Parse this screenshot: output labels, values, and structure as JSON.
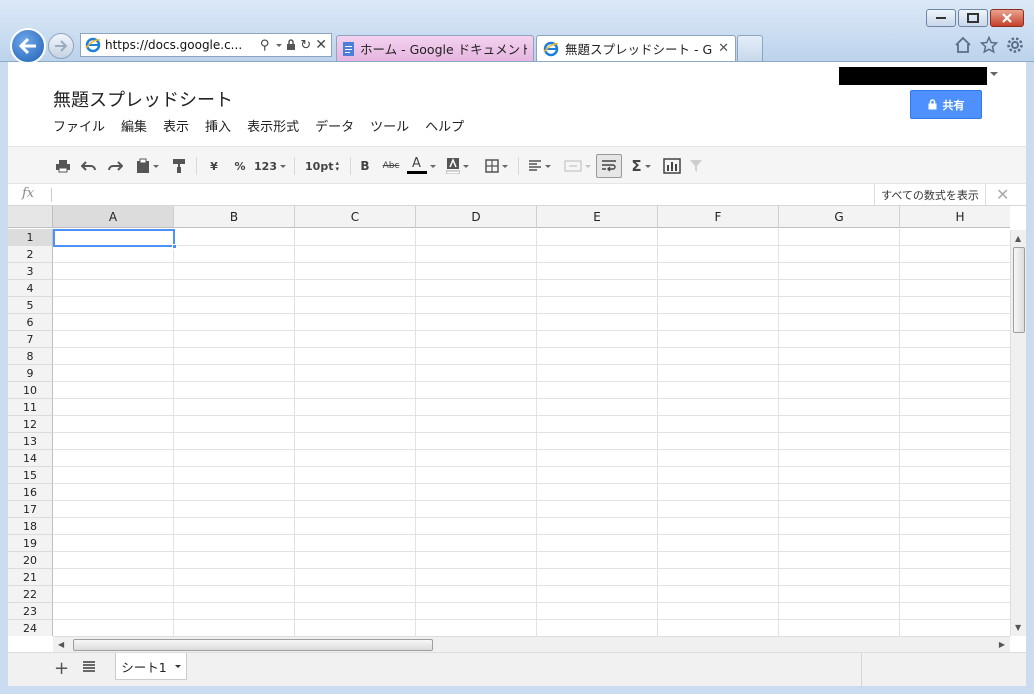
{
  "browser": {
    "url": "https://docs.google.c...",
    "tabs": [
      {
        "title": "ホーム - Google ドキュメント"
      },
      {
        "title": "無題スプレッドシート - G..."
      }
    ]
  },
  "doc": {
    "title": "無題スプレッドシート",
    "share_label": "共有"
  },
  "menu": [
    "ファイル",
    "編集",
    "表示",
    "挿入",
    "表示形式",
    "データ",
    "ツール",
    "ヘルプ"
  ],
  "toolbar": {
    "currency": "¥",
    "percent": "%",
    "number_format": "123",
    "font_size": "10pt",
    "bold": "B",
    "strike": "Abc",
    "text_color": "A",
    "sum": "Σ"
  },
  "formula_bar": {
    "fx": "fx",
    "show_formulas": "すべての数式を表示"
  },
  "grid": {
    "columns": [
      "A",
      "B",
      "C",
      "D",
      "E",
      "F",
      "G",
      "H"
    ],
    "rows": [
      "1",
      "2",
      "3",
      "4",
      "5",
      "6",
      "7",
      "8",
      "9",
      "10",
      "11",
      "12",
      "13",
      "14",
      "15",
      "16",
      "17",
      "18",
      "19",
      "20",
      "21",
      "22",
      "23",
      "24"
    ],
    "selected_cell": "A1"
  },
  "sheets": [
    {
      "name": "シート1"
    }
  ],
  "colors": {
    "accent": "#4d90fe",
    "header_bg": "#f3f3f3"
  }
}
